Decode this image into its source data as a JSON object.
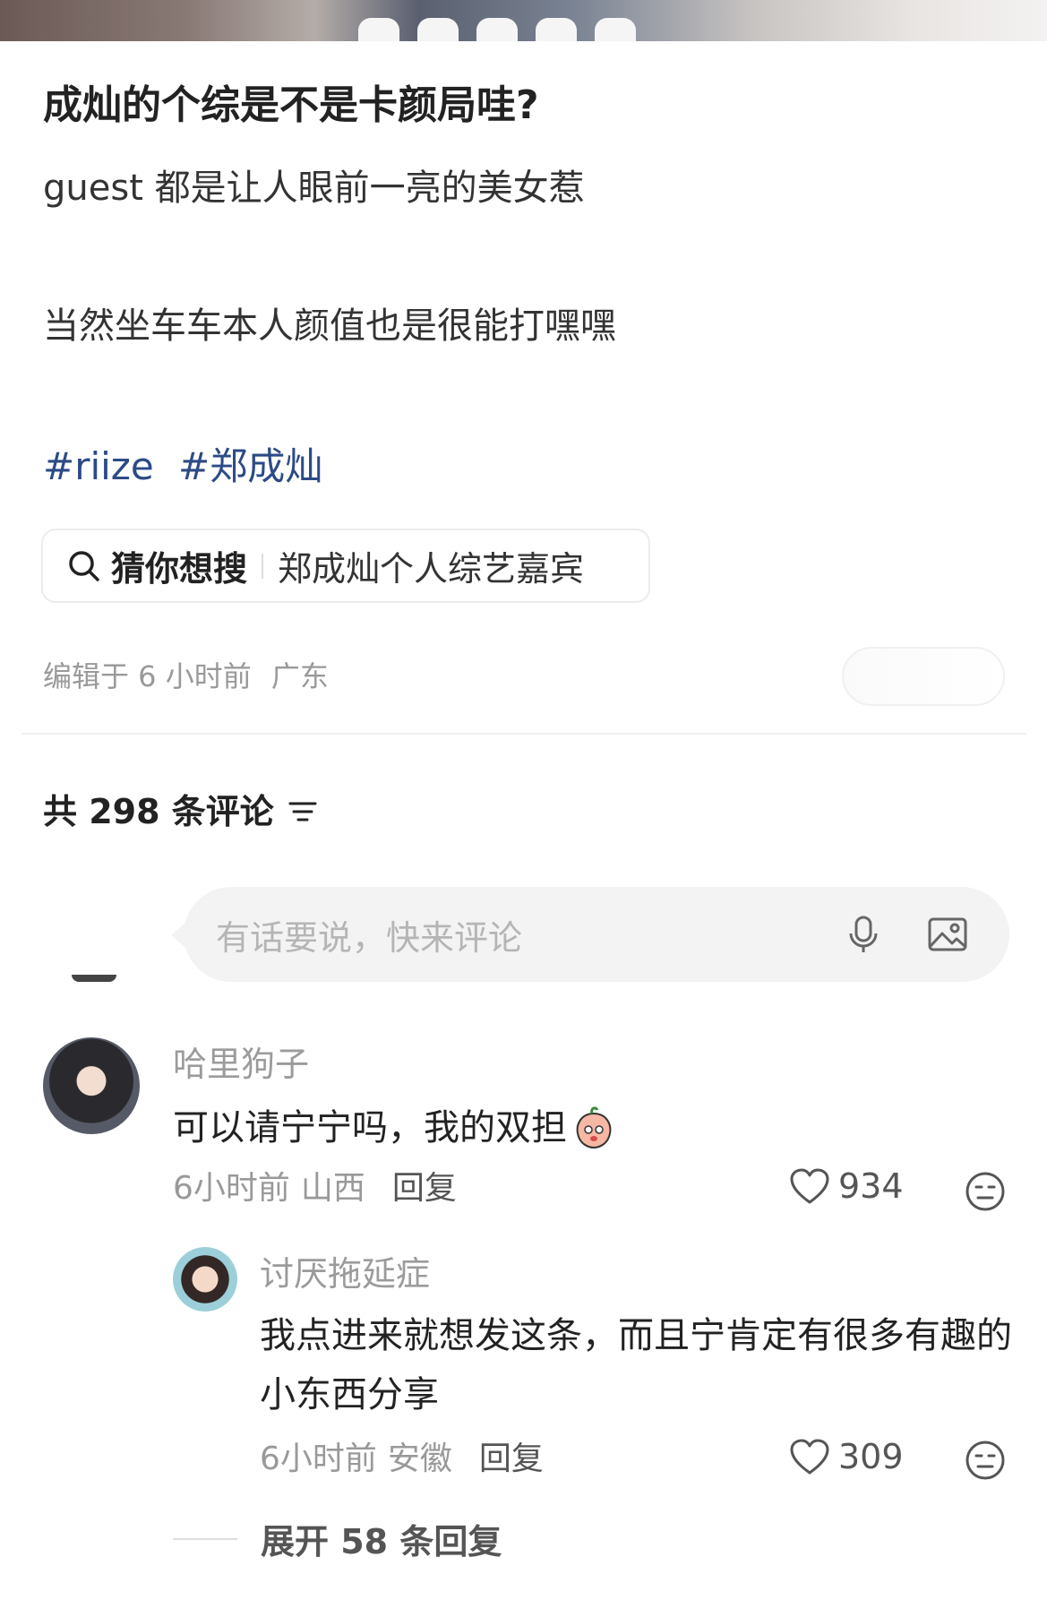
{
  "post": {
    "title": "成灿的个综是不是卡颜局哇?",
    "line1": "guest 都是让人眼前一亮的美女惹",
    "line2": "当然坐车车本人颜值也是很能打嘿嘿",
    "tags": [
      "#riize",
      "#郑成灿"
    ],
    "search_chip": {
      "hint": "猜你想搜",
      "query": "郑成灿个人综艺嘉宾"
    },
    "edit_time": "编辑于 6 小时前",
    "location": "广东"
  },
  "comments_section": {
    "count_label": "共 298 条评论",
    "input_placeholder": "有话要说，快来评论"
  },
  "comments": [
    {
      "username": "哈里狗子",
      "text": "可以请宁宁吗，我的双担",
      "time": "6小时前",
      "location": "山西",
      "reply_label": "回复",
      "likes": "934"
    },
    {
      "username": "讨厌拖延症",
      "text": "我点进来就想发这条，而且宁肯定有很多有趣的小东西分享",
      "time": "6小时前",
      "location": "安徽",
      "reply_label": "回复",
      "likes": "309"
    }
  ],
  "expand_replies": "展开 58 条回复",
  "icons": {
    "search": "search-icon",
    "sort": "sort-icon",
    "mic": "microphone-icon",
    "image": "image-icon",
    "like": "heart-icon",
    "dislike": "dislike-face-icon"
  },
  "colors": {
    "tag": "#2c4a86",
    "meta": "#999999",
    "input_bg": "#f3f3f3"
  }
}
